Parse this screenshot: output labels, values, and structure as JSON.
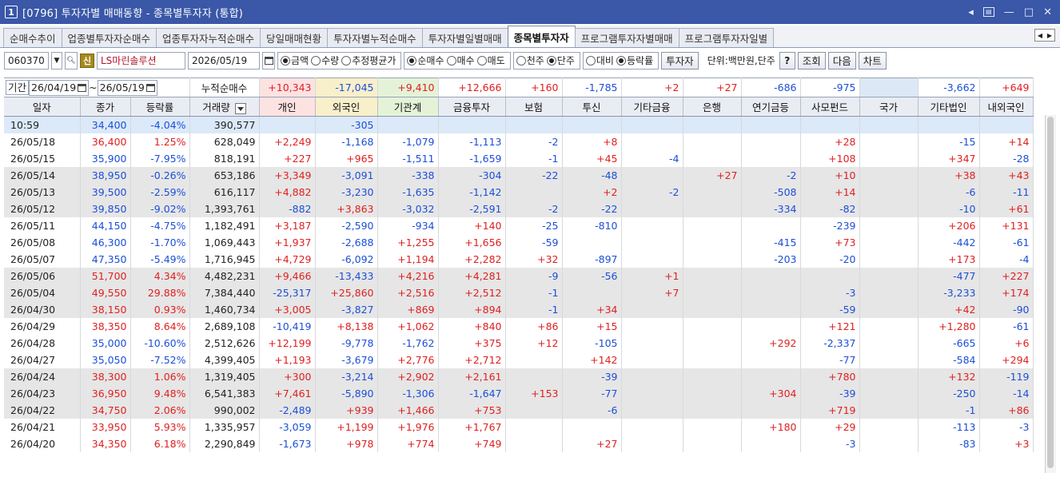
{
  "window": {
    "num": "1",
    "title": "[0796] 투자자별 매매동향 - 종목별투자자 (통합)"
  },
  "tabs": [
    "순매수추이",
    "업종별투자자순매수",
    "업종투자자누적순매수",
    "당일매매현황",
    "투자자별누적순매수",
    "투자자별일별매매",
    "종목별투자자",
    "프로그램투자자별매매",
    "프로그램투자자일별"
  ],
  "active_tab": "종목별투자자",
  "toolbar": {
    "code": "060370",
    "shin": "신",
    "name": "LS마린솔루션",
    "date": "2026/05/19",
    "radio_group1": [
      "금액",
      "수량",
      "추정평균가"
    ],
    "radio_group2": [
      "순매수",
      "매수",
      "매도"
    ],
    "radio_group3": [
      "천주",
      "단주"
    ],
    "radio_group4": [
      "대비",
      "등락률"
    ],
    "investor_btn": "투자자",
    "unit": "단위:백만원,단주",
    "help": "?",
    "query": "조회",
    "next": "다음",
    "chart": "차트"
  },
  "period": {
    "label": "기간",
    "from": "26/04/19",
    "to": "26/05/19",
    "cumulative": "누적순매수"
  },
  "summary": [
    "+10,343",
    "-17,045",
    "+9,410",
    "+12,666",
    "+160",
    "-1,785",
    "+2",
    "+27",
    "-686",
    "-975",
    "",
    "-3,662",
    "+649"
  ],
  "headers": [
    "일자",
    "종가",
    "등락률",
    "거래량",
    "개인",
    "외국인",
    "기관계",
    "금융투자",
    "보험",
    "투신",
    "기타금융",
    "은행",
    "연기금등",
    "사모펀드",
    "국가",
    "기타법인",
    "내외국인"
  ],
  "rows": [
    {
      "d": "10:59",
      "p": "34,400",
      "c": "-4.04%",
      "v": "390,577",
      "vals": [
        "",
        "-305",
        "",
        "",
        "",
        "",
        "",
        "",
        "",
        "",
        "",
        "",
        ""
      ],
      "t": "cur"
    },
    {
      "d": "26/05/18",
      "p": "36,400",
      "c": "1.25%",
      "v": "628,049",
      "vals": [
        "+2,249",
        "-1,168",
        "-1,079",
        "-1,113",
        "-2",
        "+8",
        "",
        "",
        "",
        "+28",
        "",
        "-15",
        "+14"
      ],
      "t": ""
    },
    {
      "d": "26/05/15",
      "p": "35,900",
      "c": "-7.95%",
      "v": "818,191",
      "vals": [
        "+227",
        "+965",
        "-1,511",
        "-1,659",
        "-1",
        "+45",
        "-4",
        "",
        "",
        "+108",
        "",
        "+347",
        "-28"
      ],
      "t": ""
    },
    {
      "d": "26/05/14",
      "p": "38,950",
      "c": "-0.26%",
      "v": "653,186",
      "vals": [
        "+3,349",
        "-3,091",
        "-338",
        "-304",
        "-22",
        "-48",
        "",
        "+27",
        "-2",
        "+10",
        "",
        "+38",
        "+43"
      ],
      "t": "grey"
    },
    {
      "d": "26/05/13",
      "p": "39,500",
      "c": "-2.59%",
      "v": "616,117",
      "vals": [
        "+4,882",
        "-3,230",
        "-1,635",
        "-1,142",
        "",
        "+2",
        "-2",
        "",
        "-508",
        "+14",
        "",
        "-6",
        "-11"
      ],
      "t": "grey"
    },
    {
      "d": "26/05/12",
      "p": "39,850",
      "c": "-9.02%",
      "v": "1,393,761",
      "vals": [
        "-882",
        "+3,863",
        "-3,032",
        "-2,591",
        "-2",
        "-22",
        "",
        "",
        "-334",
        "-82",
        "",
        "-10",
        "+61"
      ],
      "t": "grey"
    },
    {
      "d": "26/05/11",
      "p": "44,150",
      "c": "-4.75%",
      "v": "1,182,491",
      "vals": [
        "+3,187",
        "-2,590",
        "-934",
        "+140",
        "-25",
        "-810",
        "",
        "",
        "",
        "-239",
        "",
        "+206",
        "+131"
      ],
      "t": ""
    },
    {
      "d": "26/05/08",
      "p": "46,300",
      "c": "-1.70%",
      "v": "1,069,443",
      "vals": [
        "+1,937",
        "-2,688",
        "+1,255",
        "+1,656",
        "-59",
        "",
        "",
        "",
        "-415",
        "+73",
        "",
        "-442",
        "-61"
      ],
      "t": ""
    },
    {
      "d": "26/05/07",
      "p": "47,350",
      "c": "-5.49%",
      "v": "1,716,945",
      "vals": [
        "+4,729",
        "-6,092",
        "+1,194",
        "+2,282",
        "+32",
        "-897",
        "",
        "",
        "-203",
        "-20",
        "",
        "+173",
        "-4"
      ],
      "t": ""
    },
    {
      "d": "26/05/06",
      "p": "51,700",
      "c": "4.34%",
      "v": "4,482,231",
      "vals": [
        "+9,466",
        "-13,433",
        "+4,216",
        "+4,281",
        "-9",
        "-56",
        "+1",
        "",
        "",
        "",
        "",
        "-477",
        "+227"
      ],
      "t": "grey"
    },
    {
      "d": "26/05/04",
      "p": "49,550",
      "c": "29.88%",
      "v": "7,384,440",
      "vals": [
        "-25,317",
        "+25,860",
        "+2,516",
        "+2,512",
        "-1",
        "",
        "+7",
        "",
        "",
        "-3",
        "",
        "-3,233",
        "+174"
      ],
      "t": "grey"
    },
    {
      "d": "26/04/30",
      "p": "38,150",
      "c": "0.93%",
      "v": "1,460,734",
      "vals": [
        "+3,005",
        "-3,827",
        "+869",
        "+894",
        "-1",
        "+34",
        "",
        "",
        "",
        "-59",
        "",
        "+42",
        "-90"
      ],
      "t": "grey"
    },
    {
      "d": "26/04/29",
      "p": "38,350",
      "c": "8.64%",
      "v": "2,689,108",
      "vals": [
        "-10,419",
        "+8,138",
        "+1,062",
        "+840",
        "+86",
        "+15",
        "",
        "",
        "",
        "+121",
        "",
        "+1,280",
        "-61"
      ],
      "t": ""
    },
    {
      "d": "26/04/28",
      "p": "35,000",
      "c": "-10.60%",
      "v": "2,512,626",
      "vals": [
        "+12,199",
        "-9,778",
        "-1,762",
        "+375",
        "+12",
        "-105",
        "",
        "",
        "+292",
        "-2,337",
        "",
        "-665",
        "+6"
      ],
      "t": ""
    },
    {
      "d": "26/04/27",
      "p": "35,050",
      "c": "-7.52%",
      "v": "4,399,405",
      "vals": [
        "+1,193",
        "-3,679",
        "+2,776",
        "+2,712",
        "",
        "+142",
        "",
        "",
        "",
        "-77",
        "",
        "-584",
        "+294"
      ],
      "t": ""
    },
    {
      "d": "26/04/24",
      "p": "38,300",
      "c": "1.06%",
      "v": "1,319,405",
      "vals": [
        "+300",
        "-3,214",
        "+2,902",
        "+2,161",
        "",
        "-39",
        "",
        "",
        "",
        "+780",
        "",
        "+132",
        "-119"
      ],
      "t": "grey"
    },
    {
      "d": "26/04/23",
      "p": "36,950",
      "c": "9.48%",
      "v": "6,541,383",
      "vals": [
        "+7,461",
        "-5,890",
        "-1,306",
        "-1,647",
        "+153",
        "-77",
        "",
        "",
        "+304",
        "-39",
        "",
        "-250",
        "-14"
      ],
      "t": "grey"
    },
    {
      "d": "26/04/22",
      "p": "34,750",
      "c": "2.06%",
      "v": "990,002",
      "vals": [
        "-2,489",
        "+939",
        "+1,466",
        "+753",
        "",
        "-6",
        "",
        "",
        "",
        "+719",
        "",
        "-1",
        "+86"
      ],
      "t": "grey"
    },
    {
      "d": "26/04/21",
      "p": "33,950",
      "c": "5.93%",
      "v": "1,335,957",
      "vals": [
        "-3,059",
        "+1,199",
        "+1,976",
        "+1,767",
        "",
        "",
        "",
        "",
        "+180",
        "+29",
        "",
        "-113",
        "-3"
      ],
      "t": ""
    },
    {
      "d": "26/04/20",
      "p": "34,350",
      "c": "6.18%",
      "v": "2,290,849",
      "vals": [
        "-1,673",
        "+978",
        "+774",
        "+749",
        "",
        "+27",
        "",
        "",
        "",
        "-3",
        "",
        "-83",
        "+3"
      ],
      "t": ""
    }
  ],
  "colors": {
    "up": "#e02020",
    "down": "#1c4fd8",
    "title_bg": "#3a57a8"
  }
}
